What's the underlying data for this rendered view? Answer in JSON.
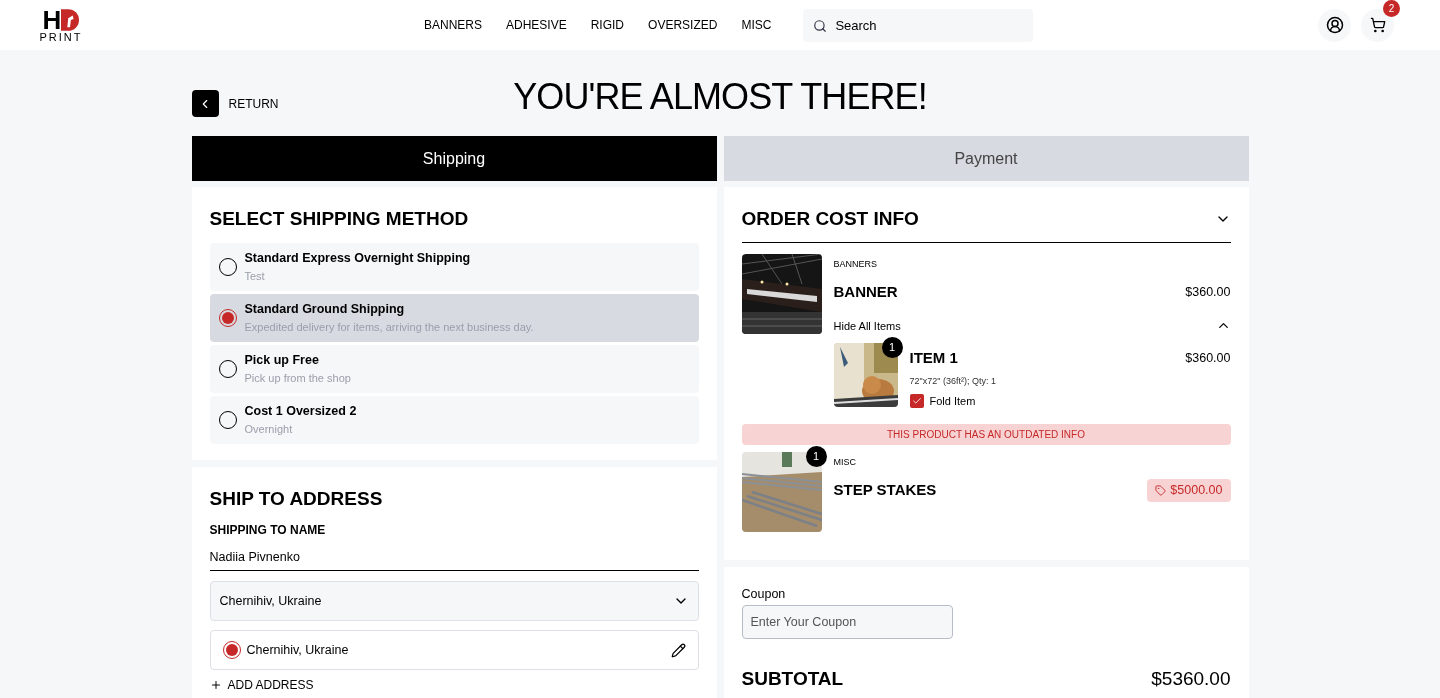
{
  "header": {
    "logo": {
      "initial": "H",
      "word": "PRINT"
    },
    "nav": [
      "BANNERS",
      "ADHESIVE",
      "RIGID",
      "OVERSIZED",
      "MISC"
    ],
    "search": {
      "placeholder": "Search"
    },
    "cart_count": "2"
  },
  "return_label": "RETURN",
  "title": "YOU'RE ALMOST THERE!",
  "tabs": [
    {
      "label": "Shipping",
      "selected": true
    },
    {
      "label": "Payment",
      "selected": false
    }
  ],
  "shipping": {
    "title": "SELECT SHIPPING METHOD",
    "options": [
      {
        "name": "Standard Express Overnight Shipping",
        "description": "Test",
        "selected": false
      },
      {
        "name": "Standard Ground Shipping",
        "description": "Expedited delivery for items, arriving the next business day.",
        "selected": true
      },
      {
        "name": "Pick up Free",
        "description": "Pick up from the shop",
        "selected": false
      },
      {
        "name": "Cost 1 Oversized 2",
        "description": "Overnight",
        "selected": false
      }
    ]
  },
  "address": {
    "title": "SHIP TO ADDRESS",
    "name_label": "SHIPPING TO NAME",
    "name_value": "Nadiia Pivnenko",
    "select_value": "Chernihiv, Ukraine",
    "addresses": [
      {
        "label": "Chernihiv, Ukraine",
        "selected": true
      }
    ],
    "add_label": "ADD ADDRESS"
  },
  "order": {
    "title": "ORDER COST INFO",
    "products": [
      {
        "kind": "banner",
        "category": "BANNERS",
        "name": "BANNER",
        "price": "$360.00",
        "outdated": false,
        "toggle_label": "Hide All Items",
        "expanded": true,
        "items": [
          {
            "kind": "cat",
            "name": "ITEM 1",
            "count": "1",
            "details": "72\"x72\" (36ft²); Qty: 1",
            "price": "$360.00",
            "fold_label": "Fold Item",
            "fold_checked": true
          }
        ]
      },
      {
        "kind": "stakes",
        "category": "MISC",
        "name": "STEP STAKES",
        "price": "$5000.00",
        "count": "1",
        "outdated": true,
        "warning": "THIS PRODUCT HAS AN OUTDATED INFO"
      }
    ]
  },
  "coupon": {
    "label": "Coupon",
    "placeholder": "Enter Your Coupon"
  },
  "subtotal": {
    "label": "SUBTOTAL",
    "value": "$5360.00"
  }
}
